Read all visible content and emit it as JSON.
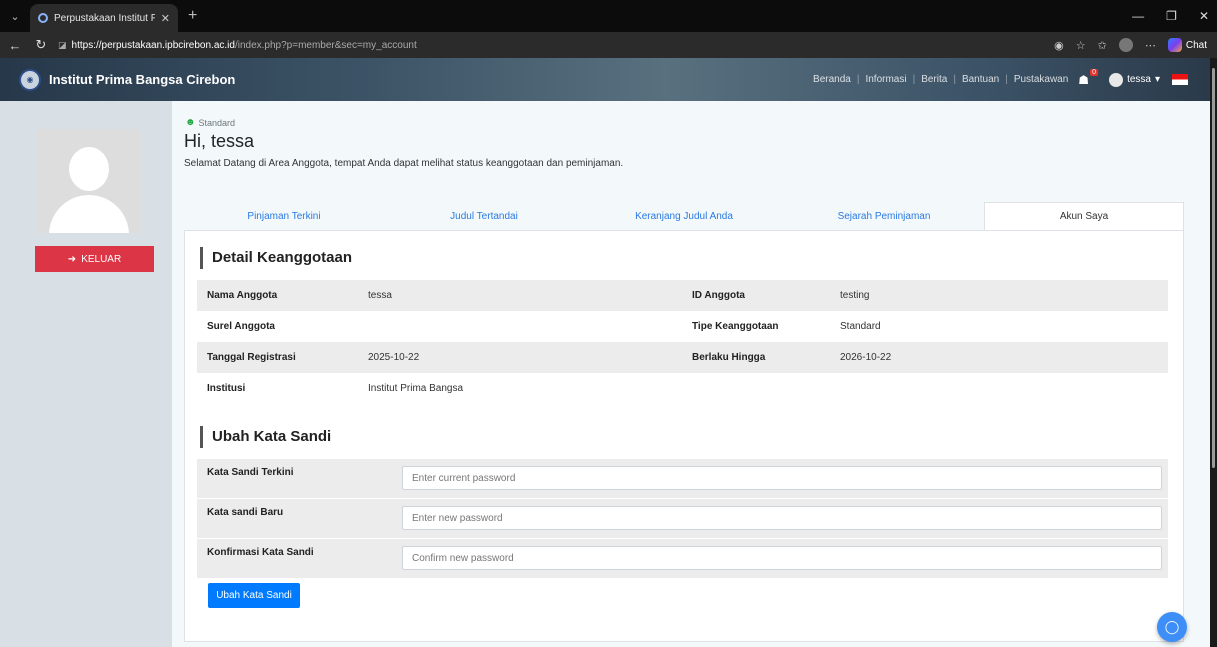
{
  "browser": {
    "tab_title": "Perpustakaan Institut Prima Bangs",
    "url_host": "https://perpustakaan.ipbcirebon.ac.id",
    "url_path": "/index.php?p=member&sec=my_account",
    "copilot_label": "Chat"
  },
  "site": {
    "brand": "Institut Prima Bangsa Cirebon",
    "nav": [
      "Beranda",
      "Informasi",
      "Berita",
      "Bantuan",
      "Pustakawan"
    ],
    "basket_count": "0",
    "username": "tessa"
  },
  "sidebar": {
    "logout_label": "KELUAR"
  },
  "main": {
    "member_type": "Standard",
    "greeting": "Hi, tessa",
    "welcome": "Selamat Datang di Area Anggota, tempat Anda dapat melihat status keanggotaan dan peminjaman.",
    "tabs": [
      "Pinjaman Terkini",
      "Judul Tertandai",
      "Keranjang Judul Anda",
      "Sejarah Peminjaman",
      "Akun Saya"
    ],
    "active_tab": "Akun Saya"
  },
  "details": {
    "title": "Detail Keanggotaan",
    "name_label": "Nama Anggota",
    "name_value": "tessa",
    "id_label": "ID Anggota",
    "id_value": "testing",
    "email_label": "Surel Anggota",
    "email_value": "",
    "type_label": "Tipe Keanggotaan",
    "type_value": "Standard",
    "reg_label": "Tanggal Registrasi",
    "reg_value": "2025-10-22",
    "expire_label": "Berlaku Hingga",
    "expire_value": "2026-10-22",
    "inst_label": "Institusi",
    "inst_value": "Institut Prima Bangsa"
  },
  "password": {
    "title": "Ubah Kata Sandi",
    "current_label": "Kata Sandi Terkini",
    "current_placeholder": "Enter current password",
    "new_label": "Kata sandi Baru",
    "new_placeholder": "Enter new password",
    "confirm_label": "Konfirmasi Kata Sandi",
    "confirm_placeholder": "Confirm new password",
    "submit_label": "Ubah Kata Sandi"
  }
}
